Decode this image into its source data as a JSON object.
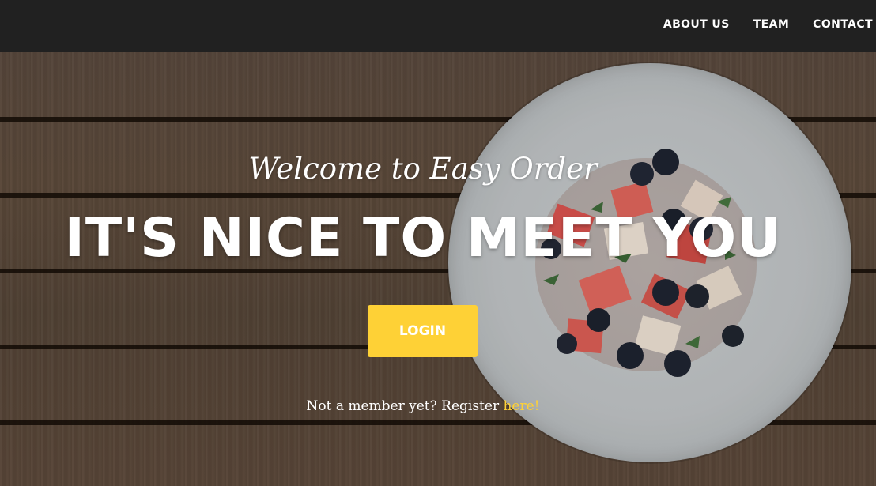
{
  "nav": {
    "links": [
      "ABOUT US",
      "TEAM",
      "CONTACT"
    ]
  },
  "hero": {
    "welcome": "Welcome to Easy Order",
    "headline": "IT'S NICE TO MEET YOU",
    "login_label": "LOGIN",
    "register_prompt": "Not a member yet? Register ",
    "register_link": "here!"
  },
  "colors": {
    "accent": "#fed136",
    "navbar": "#212121"
  }
}
